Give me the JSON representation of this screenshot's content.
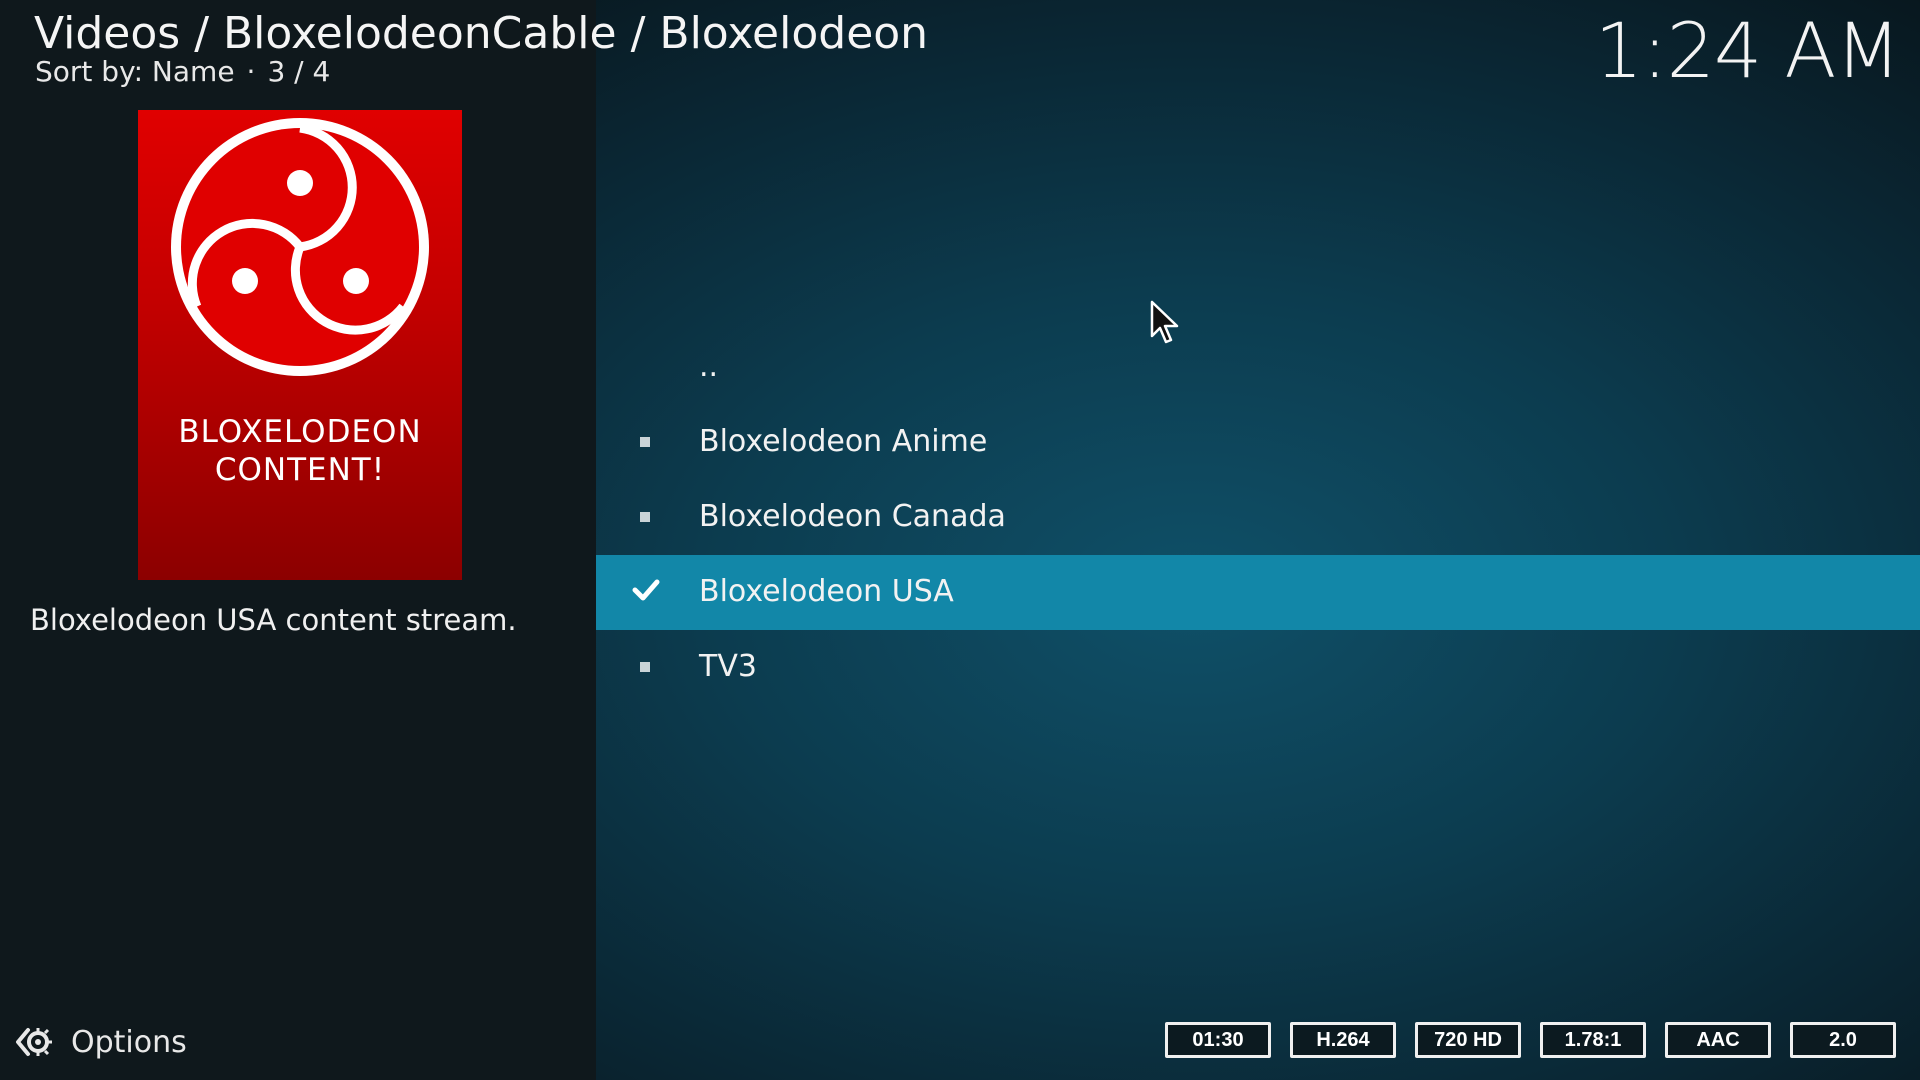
{
  "header": {
    "breadcrumb": "Videos / BloxelodeonCable / Bloxelodeon",
    "sort_label": "Sort by: Name",
    "separator": "·",
    "position": "3 / 4"
  },
  "clock": {
    "time": "1:24 AM"
  },
  "info_panel": {
    "poster": {
      "line1": "BLOXELODEON",
      "line2": "CONTENT!"
    },
    "plot": "Bloxelodeon USA content stream."
  },
  "list": {
    "items": [
      {
        "label": "..",
        "marker": "none"
      },
      {
        "label": "Bloxelodeon Anime",
        "marker": "bullet"
      },
      {
        "label": "Bloxelodeon Canada",
        "marker": "bullet"
      },
      {
        "label": "Bloxelodeon USA",
        "marker": "check",
        "selected": true
      },
      {
        "label": "TV3",
        "marker": "bullet"
      }
    ]
  },
  "options": {
    "label": "Options",
    "icon": "options-gear-icon"
  },
  "flags": {
    "duration": "01:30",
    "video_codec": "H.264",
    "resolution": "720 HD",
    "aspect": "1.78:1",
    "audio_codec": "AAC",
    "channels": "2.0"
  },
  "colors": {
    "selection": "#1287a8",
    "poster_red": "#d00000",
    "left_panel": "#0f181c"
  }
}
